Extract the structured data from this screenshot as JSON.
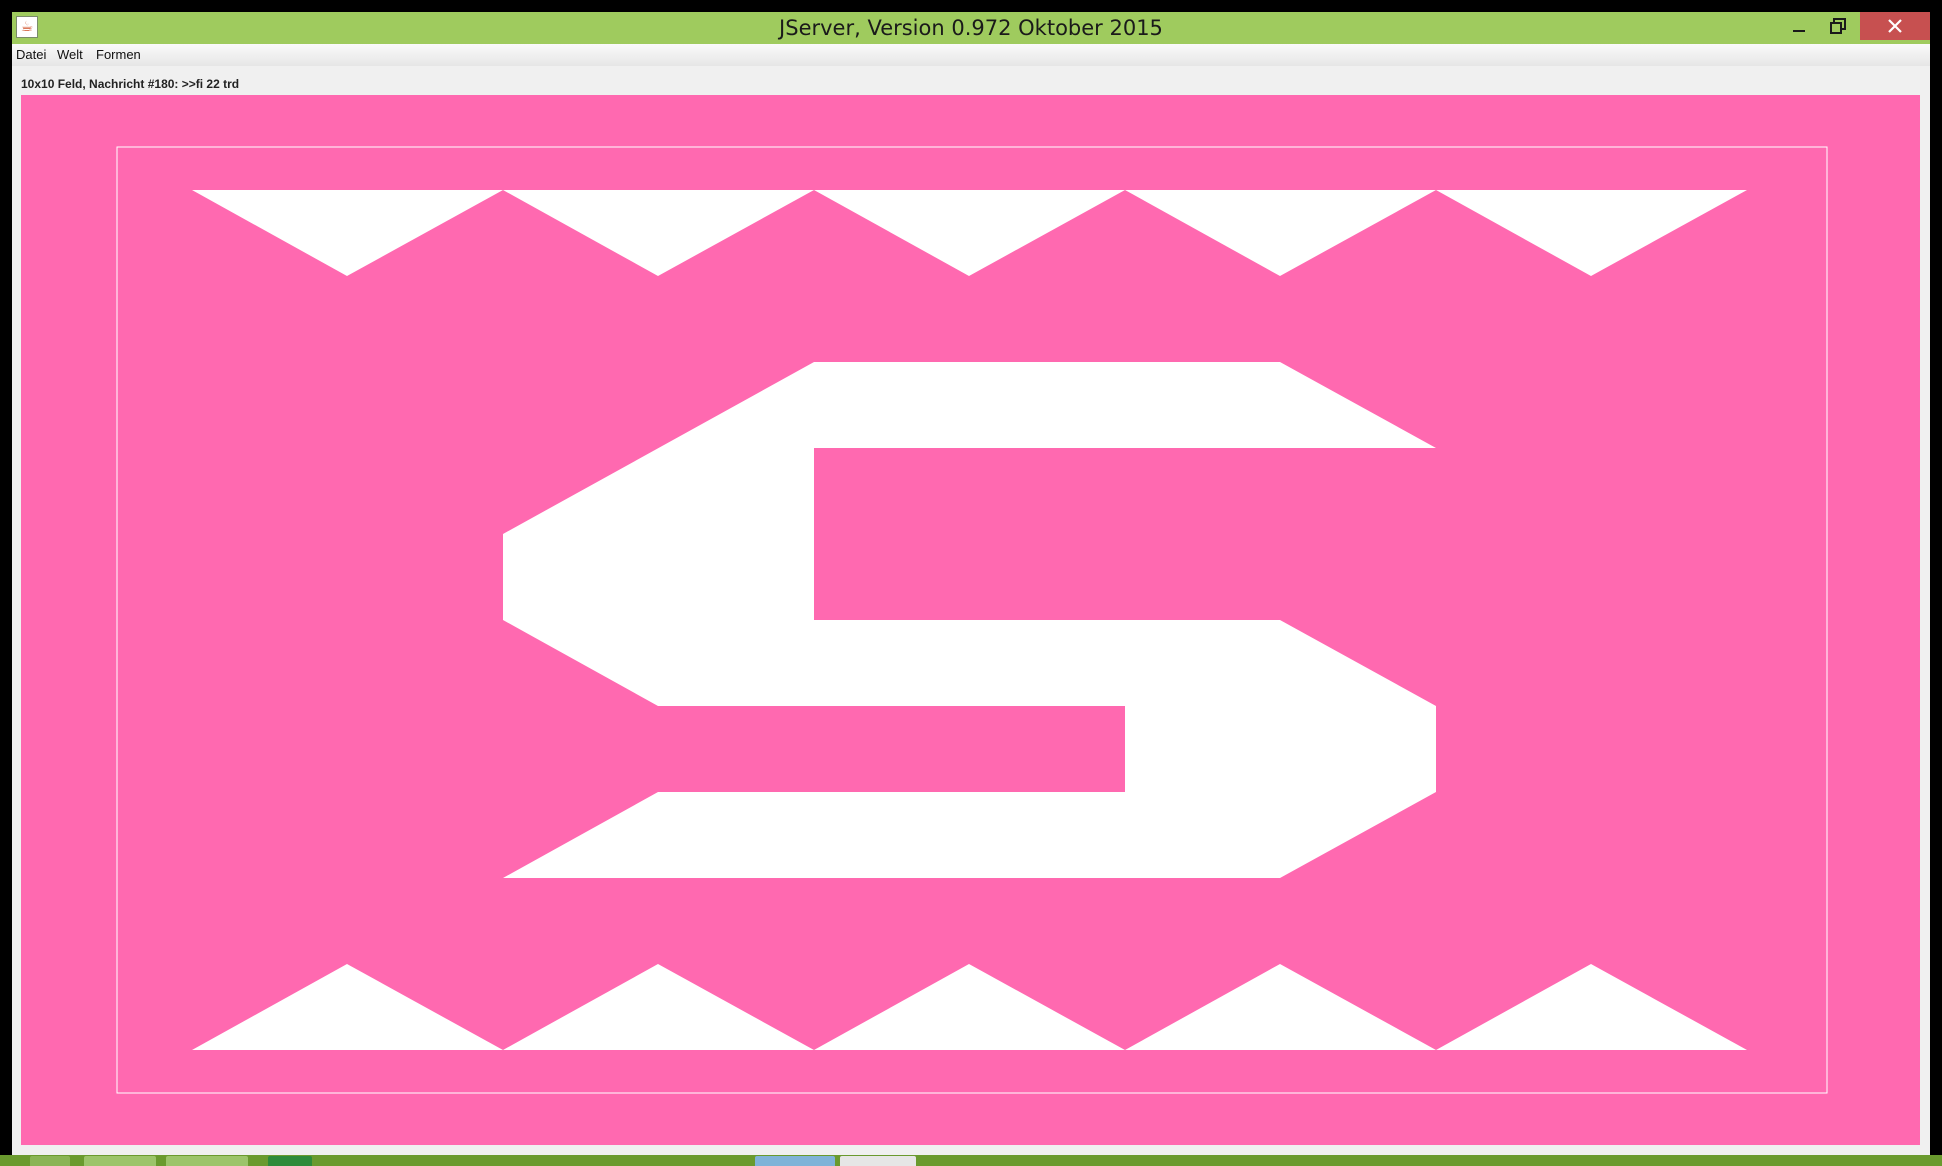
{
  "window": {
    "title": "JServer, Version 0.972 Oktober 2015",
    "app_icon": "java-icon",
    "controls": {
      "minimize": "minimize-icon",
      "maximize": "maximize-icon",
      "close": "close-icon"
    }
  },
  "menu": {
    "items": [
      {
        "label": "Datei"
      },
      {
        "label": "Welt"
      },
      {
        "label": "Formen"
      }
    ]
  },
  "status": {
    "text": "10x10 Feld, Nachricht #180: >>fi 22 trd"
  },
  "board": {
    "background_color": "#ff69b0",
    "shape_color": "#ffffff",
    "frame_color": "#ffffff",
    "letter": "S",
    "top_triangles": 5,
    "bottom_triangles": 5
  },
  "colors": {
    "titlebar": "#9fcb5e",
    "close_button": "#c75050",
    "taskbar": "#6a9a2e"
  }
}
